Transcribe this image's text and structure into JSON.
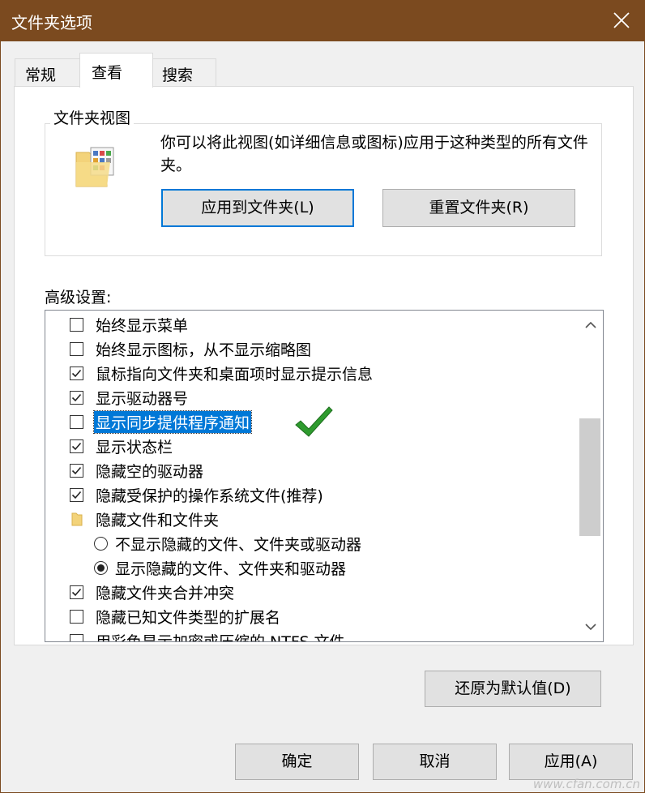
{
  "window": {
    "title": "文件夹选项"
  },
  "tabs": [
    {
      "label": "常规",
      "active": false
    },
    {
      "label": "查看",
      "active": true
    },
    {
      "label": "搜索",
      "active": false
    }
  ],
  "folder_views": {
    "title": "文件夹视图",
    "description": "你可以将此视图(如详细信息或图标)应用于这种类型的所有文件夹。",
    "apply_button": "应用到文件夹(L)",
    "reset_button": "重置文件夹(R)"
  },
  "advanced": {
    "label": "高级设置:",
    "items": [
      {
        "type": "checkbox",
        "label": "始终显示菜单",
        "checked": false
      },
      {
        "type": "checkbox",
        "label": "始终显示图标，从不显示缩略图",
        "checked": false
      },
      {
        "type": "checkbox",
        "label": "鼠标指向文件夹和桌面项时显示提示信息",
        "checked": true
      },
      {
        "type": "checkbox",
        "label": "显示驱动器号",
        "checked": true
      },
      {
        "type": "checkbox",
        "label": "显示同步提供程序通知",
        "checked": false,
        "selected": true
      },
      {
        "type": "checkbox",
        "label": "显示状态栏",
        "checked": true
      },
      {
        "type": "checkbox",
        "label": "隐藏空的驱动器",
        "checked": true
      },
      {
        "type": "checkbox",
        "label": "隐藏受保护的操作系统文件(推荐)",
        "checked": true
      },
      {
        "type": "folder",
        "label": "隐藏文件和文件夹",
        "icon": "folder-icon"
      },
      {
        "type": "radio",
        "label": "不显示隐藏的文件、文件夹或驱动器",
        "checked": false
      },
      {
        "type": "radio",
        "label": "显示隐藏的文件、文件夹和驱动器",
        "checked": true
      },
      {
        "type": "checkbox",
        "label": "隐藏文件夹合并冲突",
        "checked": true
      },
      {
        "type": "checkbox",
        "label": "隐藏已知文件类型的扩展名",
        "checked": false
      },
      {
        "type": "checkbox",
        "label": "用彩色显示加密或压缩的 NTFS 文件",
        "checked": false
      }
    ]
  },
  "restore_defaults_button": "还原为默认值(D)",
  "footer": {
    "ok": "确定",
    "cancel": "取消",
    "apply": "应用(A)"
  },
  "watermark": "www.cfan.com.cn",
  "colors": {
    "titlebar": "#7b4a1f",
    "accent": "#0078d7",
    "annotation_check": "#2e9b2e"
  }
}
